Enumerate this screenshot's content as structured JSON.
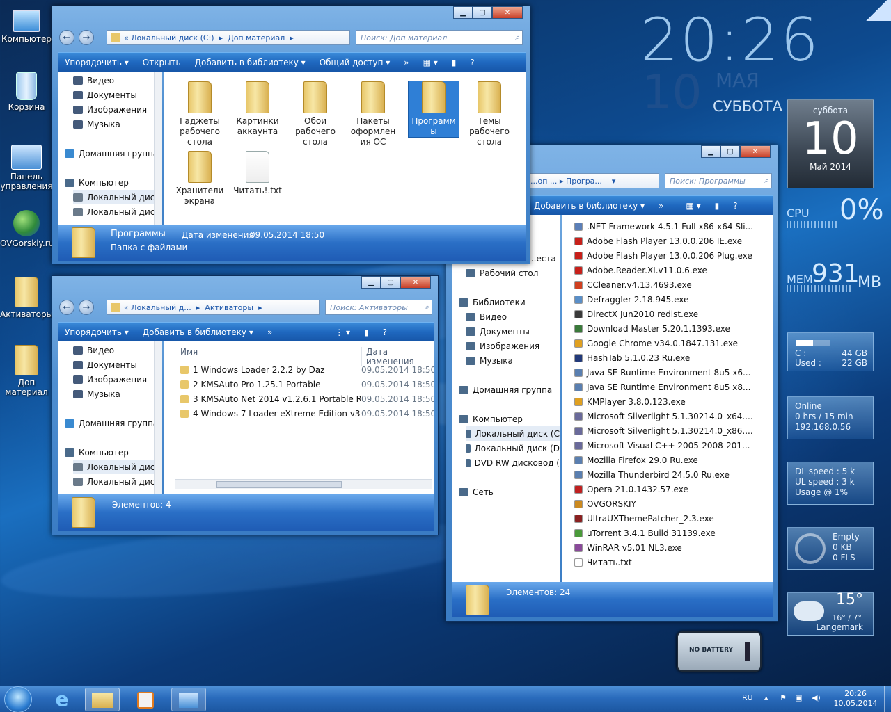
{
  "desktop": {
    "icons": [
      {
        "label": "Компьютер",
        "icon": "computer-icon"
      },
      {
        "label": "Корзина",
        "icon": "recycle-bin-icon"
      },
      {
        "label": "Панель управления",
        "icon": "control-panel-icon"
      },
      {
        "label": "OVGorskiy.ru",
        "icon": "web-globe-icon"
      },
      {
        "label": "Активаторы",
        "icon": "folder-icon"
      },
      {
        "label": "Доп материал",
        "icon": "folder-icon"
      }
    ]
  },
  "clock": {
    "time": "20:26",
    "day": "10",
    "month": "МАЯ",
    "weekday": "СУББОТА"
  },
  "calendar_gadget": {
    "weekday": "суббота",
    "day": "10",
    "month_year": "Май 2014"
  },
  "cpu": {
    "label": "CPU",
    "value": "0%"
  },
  "mem": {
    "label": "MEM",
    "value": "931",
    "unit": "MB"
  },
  "drive": {
    "c_label": "C :",
    "c_value": "44 GB",
    "used_label": "Used :",
    "used_value": "22 GB",
    "used_fraction": 0.5
  },
  "network": {
    "line1": "Online",
    "line2": "0 hrs / 15 min",
    "line3": "192.168.0.56"
  },
  "speed": {
    "dl": "DL speed : 5 k",
    "ul": "UL speed : 3 k",
    "usage": "Usage @ 1%"
  },
  "recycle": {
    "line1": "Empty",
    "line2": "0 KB",
    "line3": "0 FLS"
  },
  "weather": {
    "temp": "15°",
    "range": "16° / 7°",
    "city": "Langemark"
  },
  "battery": {
    "label": "NO BATTERY"
  },
  "win1": {
    "address": [
      "«",
      "Локальный диск (C:)",
      "▸",
      "Доп материал",
      "▸"
    ],
    "search_placeholder": "Поиск: Доп материал",
    "toolbar": [
      "Упорядочить ▾",
      "Открыть",
      "Добавить в библиотеку ▾",
      "Общий доступ ▾",
      "»"
    ],
    "nav": [
      "Видео",
      "Документы",
      "Изображения",
      "Музыка",
      "Домашняя группа",
      "Компьютер",
      "Локальный диск",
      "Локальный диск"
    ],
    "folders": [
      {
        "label": "Гаджеты рабочего стола"
      },
      {
        "label": "Картинки аккаунта"
      },
      {
        "label": "Обои рабочего стола"
      },
      {
        "label": "Пакеты оформлен ия ОС"
      },
      {
        "label": "Программ ы"
      },
      {
        "label": "Темы рабочего стола"
      },
      {
        "label": "Хранители экрана"
      },
      {
        "label": "Читать!.txt"
      }
    ],
    "status_name": "Программы",
    "status_type": "Папка с файлами",
    "status_date_label": "Дата изменения:",
    "status_date": "09.05.2014 18:50"
  },
  "win2": {
    "address": [
      "«",
      "Локальный д...",
      "▸",
      "Активаторы",
      "▸"
    ],
    "search_placeholder": "Поиск: Активаторы",
    "toolbar": [
      "Упорядочить ▾",
      "Добавить в библиотеку ▾",
      "»"
    ],
    "nav": [
      "Видео",
      "Документы",
      "Изображения",
      "Музыка",
      "Домашняя группа",
      "Компьютер",
      "Локальный диск",
      "Локальный диск"
    ],
    "col_name": "Имя",
    "col_date": "Дата изменения",
    "files": [
      {
        "name": "1 Windows Loader 2.2.2 by Daz",
        "date": "09.05.2014 18:50"
      },
      {
        "name": "2 KMSAuto Pro 1.25.1 Portable",
        "date": "09.05.2014 18:50"
      },
      {
        "name": "3 KMSAuto Net 2014 v1.2.6.1 Portable RU",
        "date": "09.05.2014 18:50"
      },
      {
        "name": "4 Windows 7 Loader eXtreme Edition v3.5...",
        "date": "09.05.2014 18:50"
      }
    ],
    "status": "Элементов: 4"
  },
  "win3": {
    "address": [
      "...оп ...",
      "▸",
      "Програ...",
      "▾"
    ],
    "search_placeholder": "Поиск: Программы",
    "toolbar": [
      "Добавить в библиотеку ▾",
      "»"
    ],
    "nav": [
      "...еста",
      "Рабочий стол",
      "Библиотеки",
      "Видео",
      "Документы",
      "Изображения",
      "Музыка",
      "Домашняя группа",
      "Компьютер",
      "Локальный диск (С",
      "Локальный диск (D",
      "DVD RW дисковод (",
      "Сеть"
    ],
    "files": [
      ".NET Framework 4.5.1 Full x86-x64 Sli...",
      "Adobe Flash Player 13.0.0.206 IE.exe",
      "Adobe Flash Player 13.0.0.206 Plug.exe",
      "Adobe.Reader.XI.v11.0.6.exe",
      "CCleaner.v4.13.4693.exe",
      "Defraggler 2.18.945.exe",
      "DirectX Jun2010 redist.exe",
      "Download Master 5.20.1.1393.exe",
      "Google Chrome v34.0.1847.131.exe",
      "HashTab 5.1.0.23 Ru.exe",
      "Java SE Runtime Environment 8u5 x6...",
      "Java SE Runtime Environment 8u5 x8...",
      "KMPlayer 3.8.0.123.exe",
      "Microsoft Silverlight 5.1.30214.0_x64....",
      "Microsoft Silverlight 5.1.30214.0_x86....",
      "Microsoft Visual C++ 2005-2008-201...",
      "Mozilla Firefox 29.0 Ru.exe",
      "Mozilla Thunderbird 24.5.0 Ru.exe",
      "Opera 21.0.1432.57.exe",
      "OVGORSKIY",
      "UltraUXThemePatcher_2.3.exe",
      "uTorrent 3.4.1 Build 31139.exe",
      "WinRAR v5.01 NL3.exe",
      "Читать.txt"
    ],
    "file_colors": [
      "#5b7fb8",
      "#c8201a",
      "#c8201a",
      "#c8201a",
      "#d04020",
      "#5a8fc8",
      "#3a3a3a",
      "#3a7a3a",
      "#e0a020",
      "#223a7a",
      "#5a7fb0",
      "#5a7fb0",
      "#e0a020",
      "#6a6a9a",
      "#6a6a9a",
      "#6a6a9a",
      "#5a7fb0",
      "#5a7fb0",
      "#c02020",
      "#cc8a20",
      "#8a2020",
      "#4a9a3a",
      "#8a4a9a",
      "#ffffff"
    ],
    "status": "Элементов: 24"
  },
  "taskbar": {
    "lang": "RU",
    "time": "20:26",
    "date": "10.05.2014"
  }
}
